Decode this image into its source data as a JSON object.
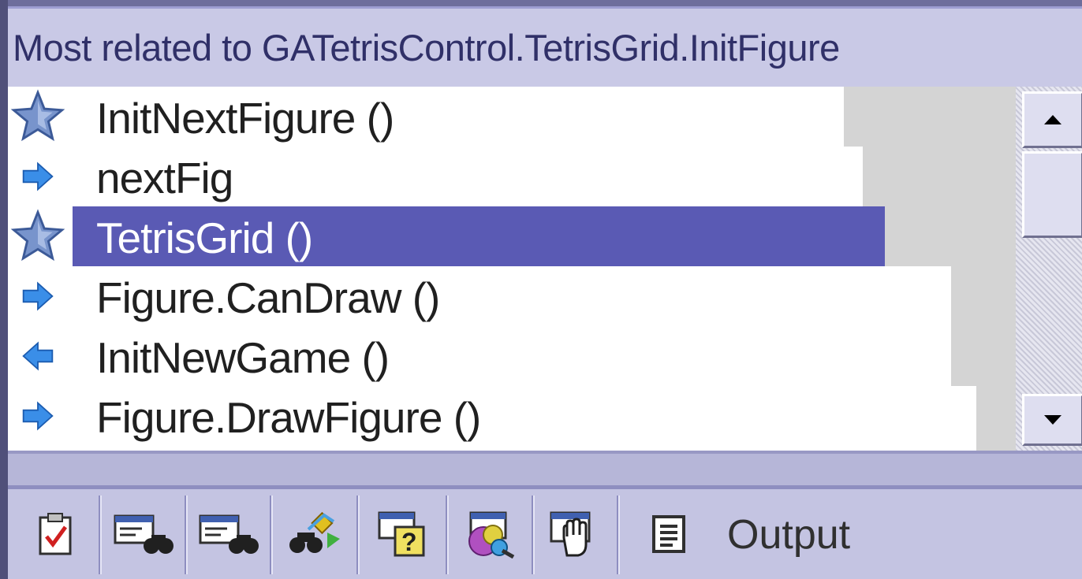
{
  "panel": {
    "title": "Most related to GATetrisControl.TetrisGrid.InitFigure"
  },
  "list": {
    "items": [
      {
        "label": "InitNextFigure ()",
        "icon": "star-icon",
        "selected": false
      },
      {
        "label": "nextFig",
        "icon": "arrow-right-icon",
        "selected": false
      },
      {
        "label": "TetrisGrid ()",
        "icon": "star-icon",
        "selected": true
      },
      {
        "label": "Figure.CanDraw ()",
        "icon": "arrow-right-icon",
        "selected": false
      },
      {
        "label": "InitNewGame ()",
        "icon": "arrow-left-icon",
        "selected": false
      },
      {
        "label": "Figure.DrawFigure ()",
        "icon": "arrow-right-icon",
        "selected": false
      }
    ]
  },
  "toolbar": {
    "buttons": [
      "task-list-icon",
      "find-results-1-icon",
      "find-results-2-icon",
      "find-symbol-icon",
      "help-icon",
      "object-browser-icon",
      "hand-icon",
      "document-icon"
    ],
    "output_label": "Output"
  },
  "colors": {
    "selection": "#5a5ab4",
    "panel_bg": "#c9c9e6",
    "title_text": "#303068",
    "arrow_blue": "#3a8ee8",
    "star_blue": "#5878b8"
  }
}
